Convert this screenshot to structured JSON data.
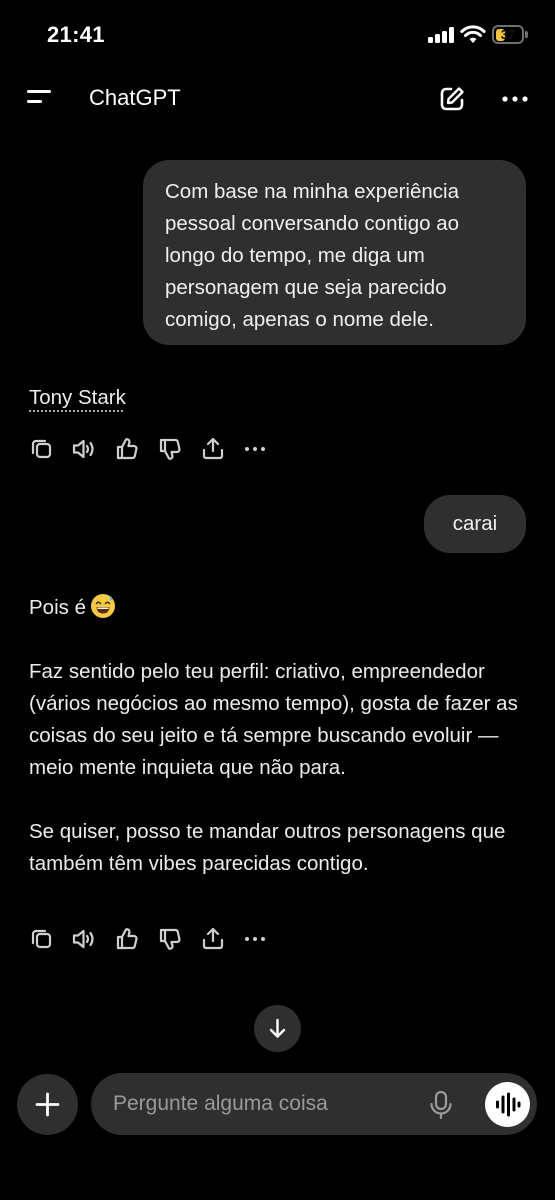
{
  "status_bar": {
    "time": "21:41",
    "battery": "37"
  },
  "header": {
    "title": "ChatGPT"
  },
  "messages": {
    "user_1": "Com base na minha experiência pessoal conversando contigo ao longo do tempo, me diga um personagem que seja parecido comigo, apenas o nome dele.",
    "assistant_1": "Tony Stark",
    "user_2": "carai",
    "assistant_2": {
      "line_1": "Pois é",
      "emoji": "grinning-sweat-emoji",
      "paragraph_2": "Faz sentido pelo teu perfil: criativo, empreendedor (vários negócios ao mesmo tempo), gosta de fazer as coisas do seu jeito e tá sempre buscando evoluir — meio mente inquieta que não para.",
      "paragraph_3": "Se quiser, posso te mandar outros personagens que também têm vibes parecidas contigo."
    }
  },
  "message_actions": [
    "copy-icon",
    "read-aloud-icon",
    "thumbs-up-icon",
    "thumbs-down-icon",
    "share-icon",
    "more-icon"
  ],
  "composer": {
    "placeholder": "Pergunte alguma coisa"
  },
  "colors": {
    "background": "#000000",
    "bubble": "#2f2f2f",
    "text": "#ececec",
    "battery": "#f5c542"
  }
}
